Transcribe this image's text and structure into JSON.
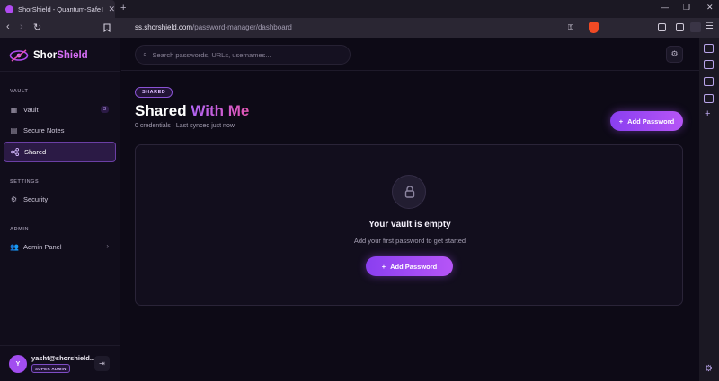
{
  "browser": {
    "tab_title": "ShorShield - Quantum-Safe Pas",
    "url_host": "ss.shorshield.com",
    "url_path": "/password-manager/dashboard"
  },
  "brand": {
    "name_part1": "Shor",
    "name_part2": "Shield"
  },
  "search": {
    "placeholder": "Search passwords, URLs, usernames..."
  },
  "sidebar": {
    "vault_label": "VAULT",
    "settings_label": "SETTINGS",
    "admin_label": "ADMIN",
    "items": [
      {
        "label": "Vault",
        "badge": "3"
      },
      {
        "label": "Secure Notes"
      },
      {
        "label": "Shared"
      },
      {
        "label": "Security"
      },
      {
        "label": "Admin Panel"
      }
    ]
  },
  "user": {
    "initial": "Y",
    "name": "yasht@shorshield...",
    "role": "SUPER ADMIN"
  },
  "main": {
    "tag": "SHARED",
    "title_part1": "Shared ",
    "title_part2": "With Me",
    "subtitle": "0 credentials · Last synced just now",
    "add_button": "Add Password",
    "empty_title": "Your vault is empty",
    "empty_subtitle": "Add your first password to get started",
    "empty_button": "Add Password"
  },
  "colors": {
    "accent": "#9b47f2",
    "background": "#0d0a16",
    "brave": "#f04a24"
  }
}
